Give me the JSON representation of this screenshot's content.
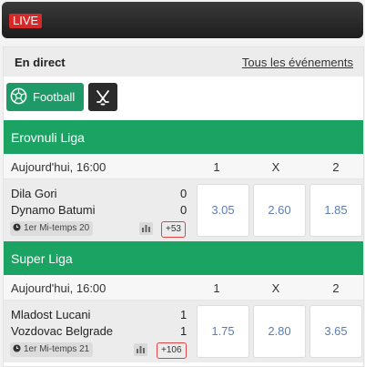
{
  "topbar": {
    "live_label": "LIVE"
  },
  "section": {
    "title": "En direct",
    "all_events_label": "Tous les événements"
  },
  "sports": [
    {
      "label": "Football",
      "icon": "football-icon",
      "color": "#1d9a68"
    },
    {
      "label": "",
      "icon": "hockey-icon",
      "color": "#2b2b2b"
    }
  ],
  "columns": [
    "1",
    "X",
    "2"
  ],
  "leagues": [
    {
      "name": "Erovnuli Liga",
      "date": "Aujourd'hui, 16:00",
      "match": {
        "home": "Dila Gori",
        "away": "Dynamo Batumi",
        "home_score": "0",
        "away_score": "0",
        "status": "1er Mi-temps 20",
        "more": "+53",
        "odds": [
          "3.05",
          "2.60",
          "1.85"
        ]
      }
    },
    {
      "name": "Super Liga",
      "date": "Aujourd'hui, 16:00",
      "match": {
        "home": "Mladost Lucani",
        "away": "Vozdovac Belgrade",
        "home_score": "1",
        "away_score": "1",
        "status": "1er Mi-temps 21",
        "more": "+106",
        "odds": [
          "1.75",
          "2.80",
          "3.65"
        ]
      }
    }
  ],
  "colors": {
    "accent_green": "#1ba364",
    "odds_text": "#5b7db4",
    "live_red": "#d92828"
  }
}
